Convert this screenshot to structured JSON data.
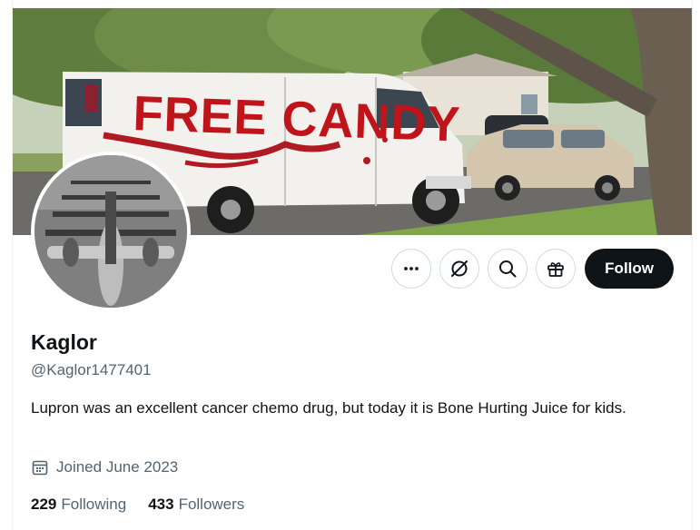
{
  "profile": {
    "display_name": "Kaglor",
    "handle": "@Kaglor1477401",
    "bio": "Lupron was an excellent cancer chemo drug, but today it is Bone Hurting Juice for kids.",
    "joined": "Joined June 2023"
  },
  "banner": {
    "van_text": "FREE CANDY"
  },
  "actions": {
    "more_icon": "more-icon",
    "grok_icon": "grok-icon",
    "search_icon": "search-icon",
    "gift_icon": "gift-icon",
    "follow_label": "Follow"
  },
  "stats": {
    "following_count": "229",
    "following_label": "Following",
    "followers_count": "433",
    "followers_label": "Followers"
  },
  "colors": {
    "primary_text": "#0f1419",
    "secondary_text": "#536471",
    "border": "#cfd9de",
    "follow_bg": "#0f1419",
    "van_text": "#c0141b"
  }
}
